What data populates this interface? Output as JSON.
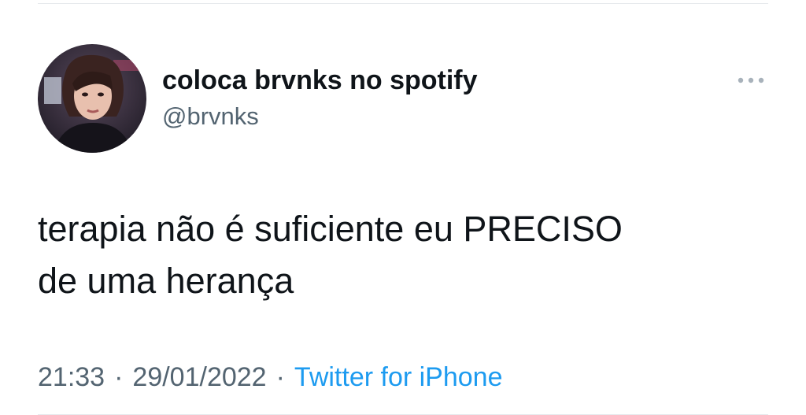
{
  "tweet": {
    "display_name": "coloca brvnks no spotify",
    "handle": "@brvnks",
    "text_line1": "terapia não é suficiente eu PRECISO",
    "text_line2": "de uma herança",
    "time": "21:33",
    "date": "29/01/2022",
    "separator": "·",
    "source": "Twitter for iPhone"
  },
  "icons": {
    "more": "more-horizontal-icon",
    "avatar": "profile-avatar"
  },
  "colors": {
    "text": "#0f1419",
    "secondary": "#536471",
    "link": "#1d9bf0",
    "divider": "#e6e9ec"
  }
}
